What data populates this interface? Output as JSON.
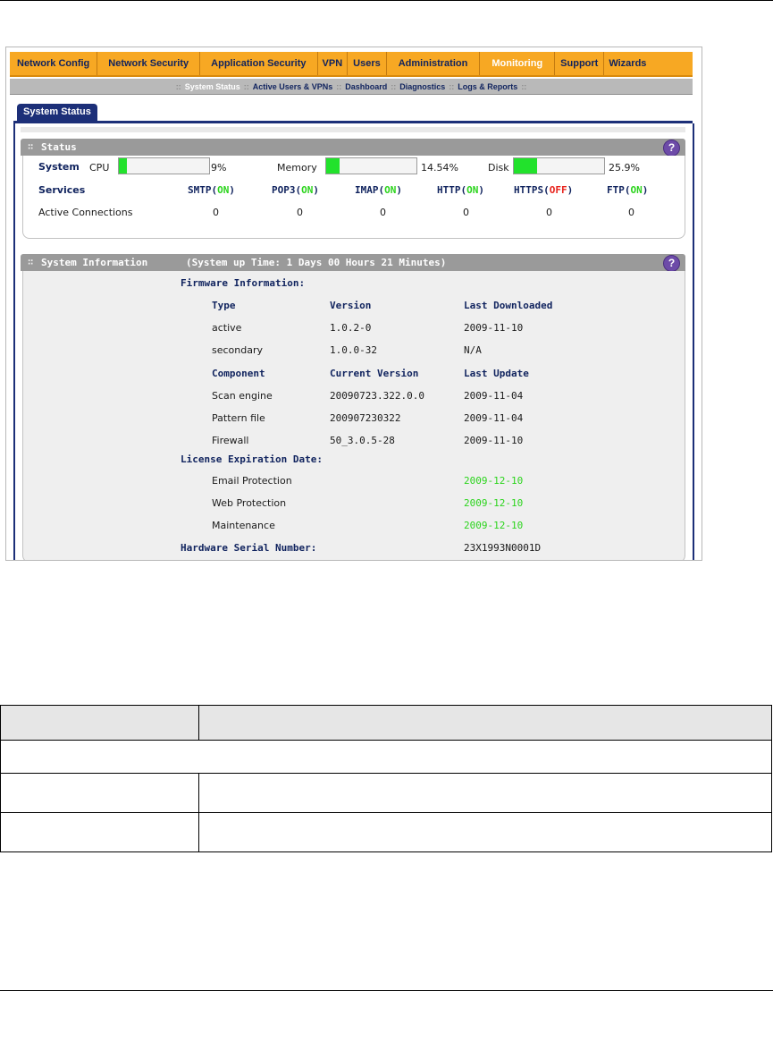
{
  "nav": {
    "top": [
      "Network Config",
      "Network Security",
      "Application Security",
      "VPN",
      "Users",
      "Administration",
      "Monitoring",
      "Support",
      "Wizards"
    ],
    "active_top": "Monitoring",
    "sub": [
      "System Status",
      "Active Users & VPNs",
      "Dashboard",
      "Diagnostics",
      "Logs & Reports"
    ],
    "active_sub": "System Status",
    "sep": "::"
  },
  "tab": {
    "label": "System Status"
  },
  "status": {
    "header": "Status",
    "help": "?",
    "system_label": "System",
    "cpu_label": "CPU",
    "cpu_value": "9%",
    "cpu_fraction": 0.09,
    "memory_label": "Memory",
    "memory_value": "14.54%",
    "memory_fraction": 0.1454,
    "disk_label": "Disk",
    "disk_value": "25.9%",
    "disk_fraction": 0.259,
    "services_label": "Services",
    "services": [
      {
        "name": "SMTP(",
        "state": "ON",
        "close": ")"
      },
      {
        "name": "POP3(",
        "state": "ON",
        "close": ")"
      },
      {
        "name": "IMAP(",
        "state": "ON",
        "close": ")"
      },
      {
        "name": "HTTP(",
        "state": "ON",
        "close": ")"
      },
      {
        "name": "HTTPS(",
        "state": "OFF",
        "close": ")"
      },
      {
        "name": "FTP(",
        "state": "ON",
        "close": ")"
      }
    ],
    "active_connections_label": "Active Connections",
    "active_connections": [
      "0",
      "0",
      "0",
      "0",
      "0",
      "0"
    ]
  },
  "sysinfo": {
    "header": "System Information",
    "uptime": "(System up Time: 1 Days 00 Hours 21 Minutes)",
    "help": "?",
    "firmware_title": "Firmware Information:",
    "fw_headers": [
      "Type",
      "Version",
      "Last Downloaded"
    ],
    "fw_rows": [
      [
        "active",
        "1.0.2-0",
        "2009-11-10"
      ],
      [
        "secondary",
        "1.0.0-32",
        "N/A"
      ]
    ],
    "comp_headers": [
      "Component",
      "Current Version",
      "Last Update"
    ],
    "comp_rows": [
      [
        "Scan engine",
        "20090723.322.0.0",
        "2009-11-04"
      ],
      [
        "Pattern file",
        "200907230322",
        "2009-11-04"
      ],
      [
        "Firewall",
        "50_3.0.5-28",
        "2009-11-10"
      ]
    ],
    "license_title": "License Expiration Date:",
    "license_rows": [
      [
        "Email Protection",
        "2009-12-10"
      ],
      [
        "Web Protection",
        "2009-12-10"
      ],
      [
        "Maintenance",
        "2009-12-10"
      ]
    ],
    "serial_label": "Hardware Serial Number:",
    "serial_value": "23X1993N0001D"
  },
  "colors": {
    "nav_orange": "#f7a823",
    "navy": "#1c2f78",
    "on_green": "#2bd41c",
    "off_red": "#e8231c",
    "bar_green": "#22e22c"
  }
}
